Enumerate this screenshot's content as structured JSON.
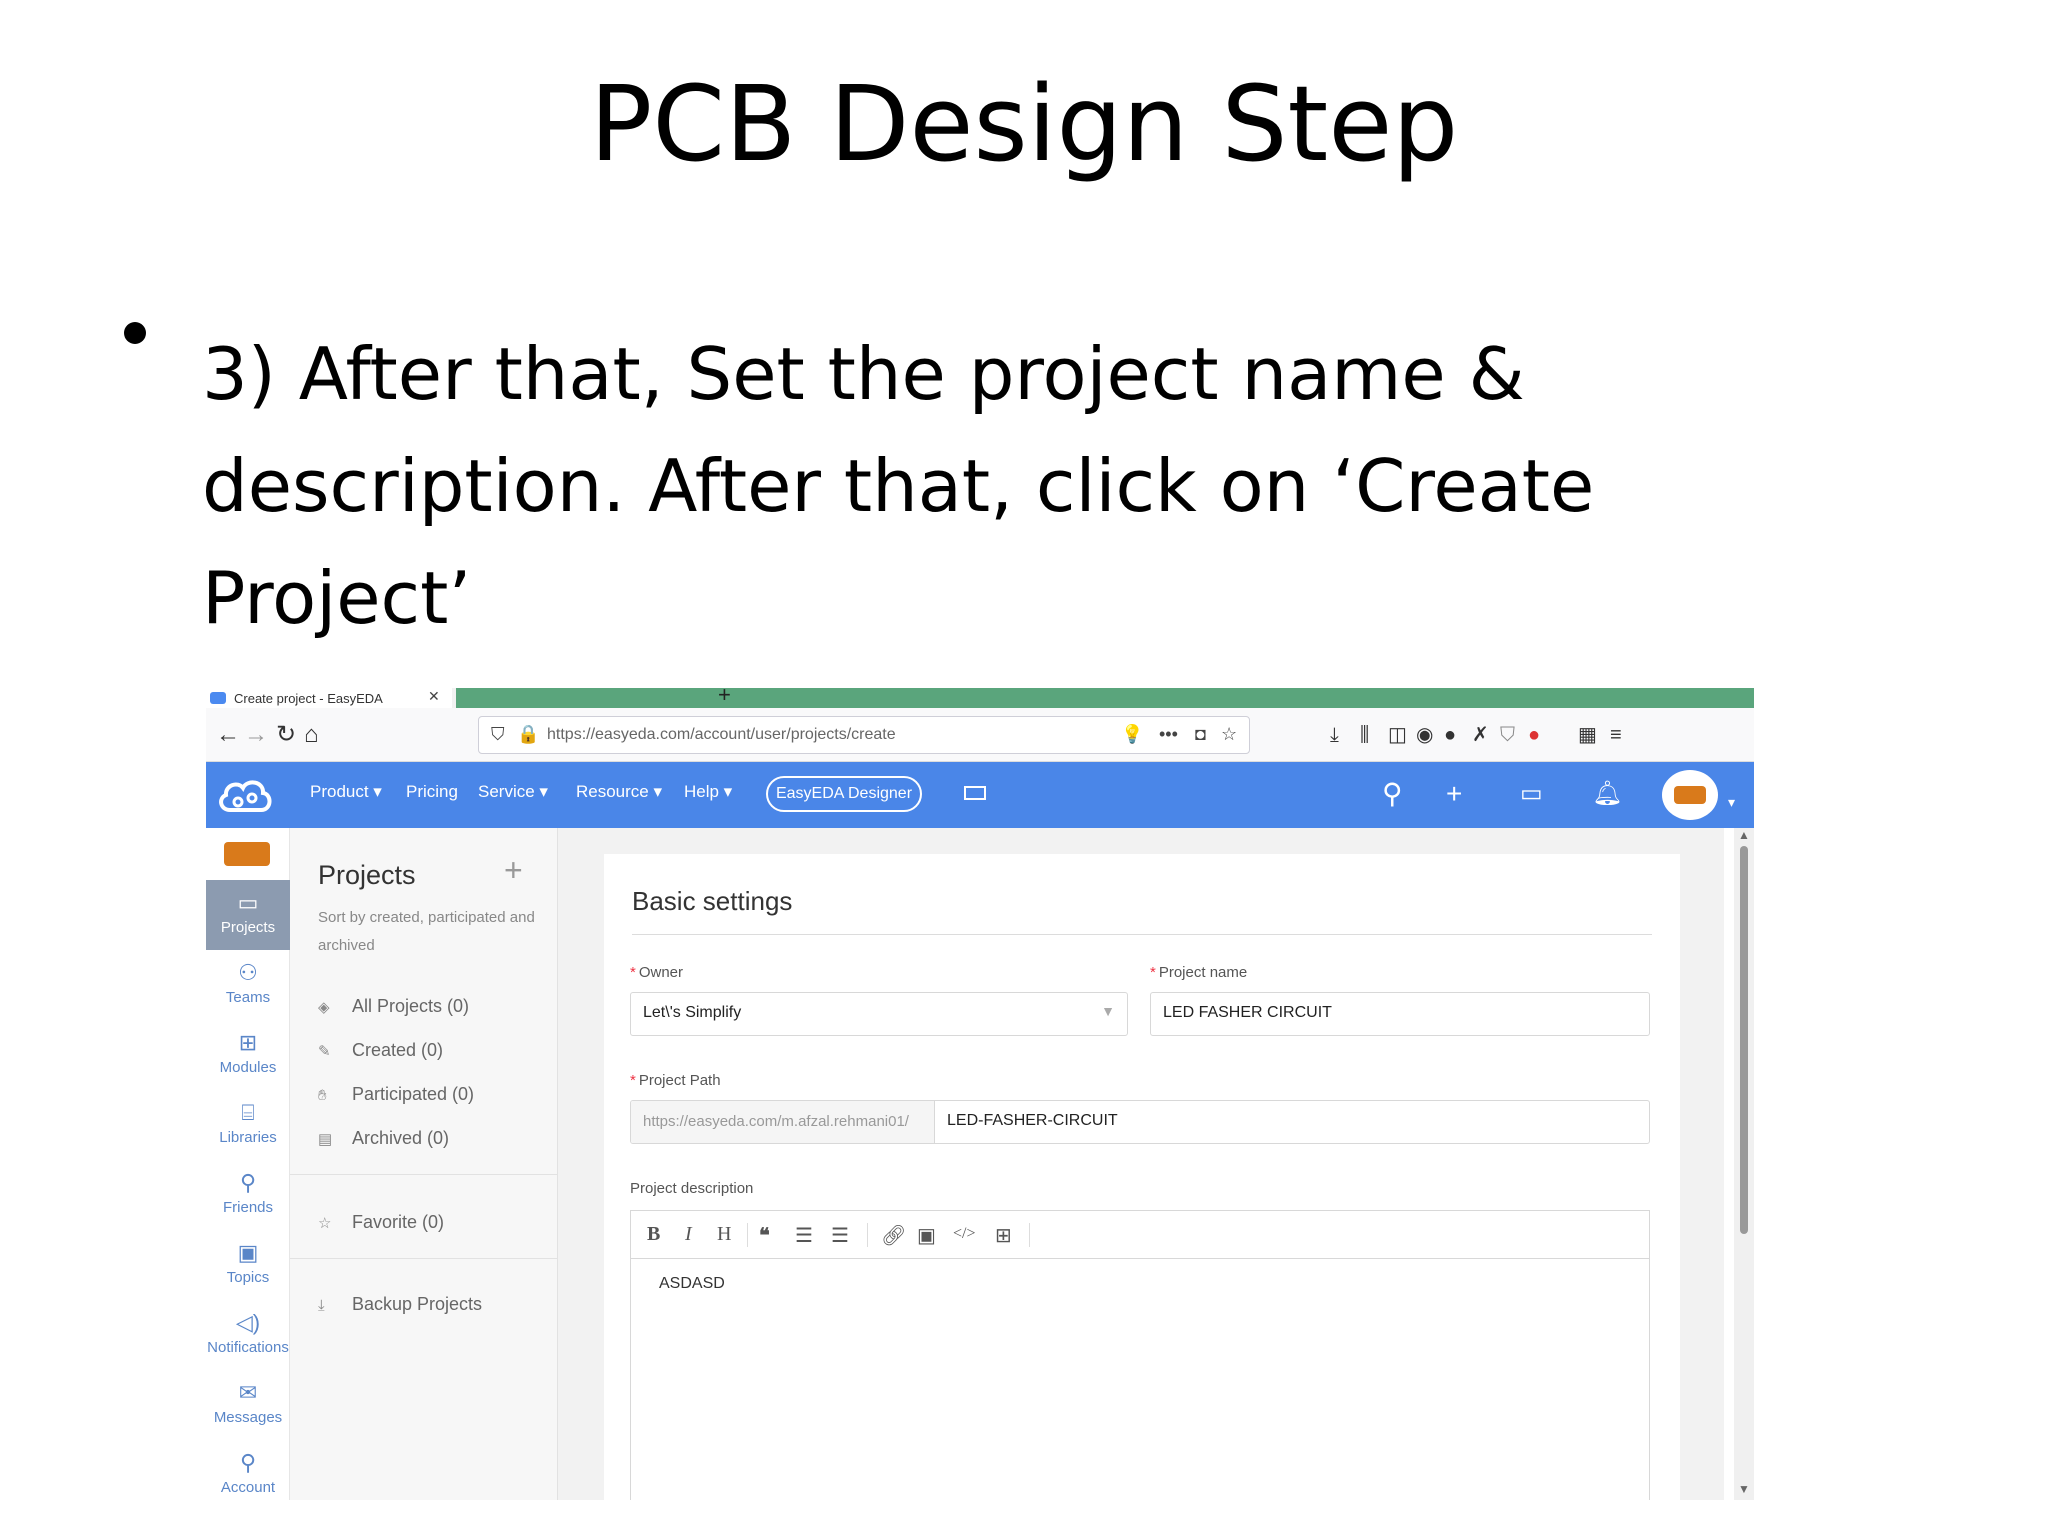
{
  "slide": {
    "title": "PCB Design Step",
    "bullet": "3) After that, Set the project name & description. After that, click on ‘Create Project’"
  },
  "browser": {
    "tab_title": "Create project - EasyEDA",
    "tab_close": "✕",
    "new_tab": "+",
    "url": "https://easyeda.com/account/user/projects/create"
  },
  "app": {
    "menu": [
      {
        "label": "Product ▾"
      },
      {
        "label": "Pricing"
      },
      {
        "label": "Service ▾"
      },
      {
        "label": "Resource ▾"
      },
      {
        "label": "Help ▾"
      }
    ],
    "designer_button": "EasyEDA Designer",
    "colors": {
      "appbar": "#4a86e8",
      "accent_tab": "#5aa57c",
      "required": "#e34"
    }
  },
  "leftnav": {
    "items": [
      {
        "label": "Projects",
        "icon": "folder-icon"
      },
      {
        "label": "Teams",
        "icon": "team-icon"
      },
      {
        "label": "Modules",
        "icon": "modules-icon"
      },
      {
        "label": "Libraries",
        "icon": "chip-icon"
      },
      {
        "label": "Friends",
        "icon": "add-friend-icon"
      },
      {
        "label": "Topics",
        "icon": "chat-icon"
      },
      {
        "label": "Notifications",
        "icon": "speaker-icon"
      },
      {
        "label": "Messages",
        "icon": "mail-icon"
      },
      {
        "label": "Account",
        "icon": "user-icon"
      }
    ]
  },
  "projects_pane": {
    "title": "Projects",
    "add": "+",
    "subtitle": "Sort by created, participated and archived",
    "items": [
      {
        "label": "All Projects (0)"
      },
      {
        "label": "Created (0)"
      },
      {
        "label": "Participated (0)"
      },
      {
        "label": "Archived (0)"
      }
    ],
    "favorite": "Favorite (0)",
    "backup": "Backup Projects"
  },
  "form": {
    "title": "Basic settings",
    "owner_label": "Owner",
    "owner_value": "Let\\'s Simplify",
    "project_name_label": "Project name",
    "project_name_value": "LED FASHER CIRCUIT",
    "project_path_label": "Project Path",
    "project_path_prefix": "https://easyeda.com/m.afzal.rehmani01/",
    "project_path_value": "LED-FASHER-CIRCUIT",
    "description_label": "Project description",
    "description_value": "ASDASD",
    "required_mark": "*"
  }
}
